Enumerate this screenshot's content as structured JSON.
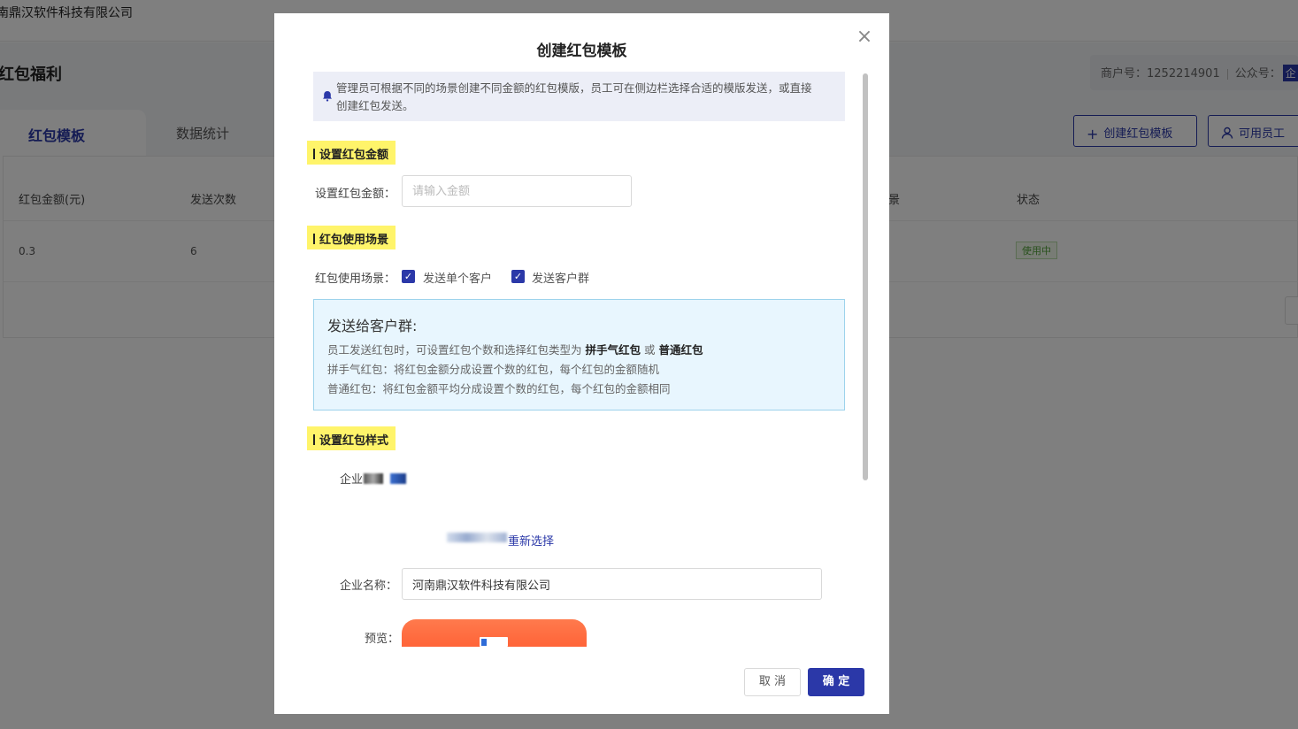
{
  "background": {
    "company_name": "南鼎汉软件科技有限公司",
    "page_title": "红包福利",
    "merchant_label": "商户号：1252214901",
    "official_label": "公众号：",
    "official_badge": "企",
    "tabs": [
      {
        "label": "红包模板",
        "active": true
      },
      {
        "label": "数据统计",
        "active": false
      }
    ],
    "buttons": {
      "create_template": "创建红包模板",
      "available_staff": "可用员工"
    },
    "table": {
      "headers": [
        "红包金额(元)",
        "发送次数",
        "景",
        "状态"
      ],
      "rows": [
        {
          "amount": "0.3",
          "count": "6",
          "status": "使用中"
        }
      ]
    }
  },
  "modal": {
    "title": "创建红包模板",
    "close_symbol": "×",
    "notice_line1": "管理员可根据不同的场景创建不同金额的红包模版，员工可在侧边栏选择合适的模版发送，或直接",
    "notice_line2": "创建红包发送。",
    "section_amount": {
      "heading": "设置红包金额",
      "label": "设置红包金额：",
      "placeholder": "请输入金额"
    },
    "section_scene": {
      "heading": "红包使用场景",
      "label": "红包使用场景：",
      "options": [
        {
          "label": "发送单个客户",
          "checked": true
        },
        {
          "label": "发送客户群",
          "checked": true
        }
      ],
      "info": {
        "title": "发送给客户群:",
        "line1_prefix": "员工发送红包时，可设置红包个数和选择红包类型为",
        "line1_type1": "拼手气红包",
        "line1_or": "或",
        "line1_type2": "普通红包",
        "line2": "拼手气红包：将红包金额分成设置个数的红包，每个红包的金额随机",
        "line3": "普通红包：将红包金额平均分成设置个数的红包，每个红包的金额相同"
      }
    },
    "section_style": {
      "heading": "设置红包样式",
      "logo_label": "企业",
      "reselect_label": "重新选择",
      "company_label": "企业名称：",
      "company_value": "河南鼎汉软件科技有限公司",
      "preview_label": "预览："
    },
    "footer": {
      "cancel": "取 消",
      "confirm": "确 定"
    }
  },
  "colors": {
    "primary": "#2b38a8",
    "highlight": "#fff46a",
    "info_bg": "#e8f6fe",
    "status_green": "#52a23a",
    "preview_orange": "#ff6b3d"
  }
}
